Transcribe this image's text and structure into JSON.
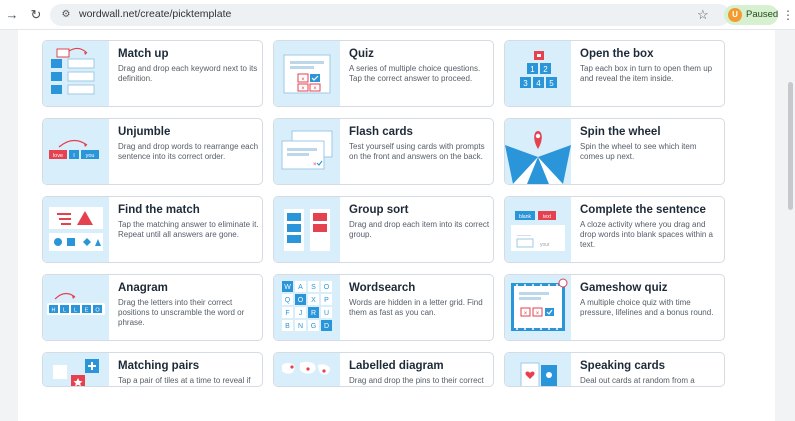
{
  "browser": {
    "url": "wordwall.net/create/picktemplate",
    "profile_status": "Paused",
    "profile_initial": "U"
  },
  "templates": [
    {
      "title": "Match up",
      "description": "Drag and drop each keyword next to its definition."
    },
    {
      "title": "Quiz",
      "description": "A series of multiple choice questions. Tap the correct answer to proceed."
    },
    {
      "title": "Open the box",
      "description": "Tap each box in turn to open them up and reveal the item inside."
    },
    {
      "title": "Unjumble",
      "description": "Drag and drop words to rearrange each sentence into its correct order."
    },
    {
      "title": "Flash cards",
      "description": "Test yourself using cards with prompts on the front and answers on the back."
    },
    {
      "title": "Spin the wheel",
      "description": "Spin the wheel to see which item comes up next."
    },
    {
      "title": "Find the match",
      "description": "Tap the matching answer to eliminate it. Repeat until all answers are gone."
    },
    {
      "title": "Group sort",
      "description": "Drag and drop each item into its correct group."
    },
    {
      "title": "Complete the sentence",
      "description": "A cloze activity where you drag and drop words into blank spaces within a text."
    },
    {
      "title": "Anagram",
      "description": "Drag the letters into their correct positions to unscramble the word or phrase."
    },
    {
      "title": "Wordsearch",
      "description": "Words are hidden in a letter grid. Find them as fast as you can."
    },
    {
      "title": "Gameshow quiz",
      "description": "A multiple choice quiz with time pressure, lifelines and a bonus round."
    },
    {
      "title": "Matching pairs",
      "description": "Tap a pair of tiles at a time to reveal if they are a match."
    },
    {
      "title": "Labelled diagram",
      "description": "Drag and drop the pins to their correct place on the image."
    },
    {
      "title": "Speaking cards",
      "description": "Deal out cards at random from a shuffled deck."
    }
  ],
  "thumb_text": {
    "box_numbers": [
      "1",
      "2",
      "3",
      "4",
      "5"
    ],
    "unjumble_words": [
      "love",
      "I",
      "you"
    ],
    "anagram_letters": [
      "H",
      "L",
      "L",
      "E",
      "O"
    ],
    "wordsearch_letters": [
      "W",
      "A",
      "S",
      "O",
      "Q",
      "O",
      "X",
      "P",
      "F",
      "J",
      "R",
      "U",
      "B",
      "N",
      "G",
      "D"
    ],
    "cloze_words": [
      "blank",
      "text"
    ],
    "cloze_placeholder": "_____",
    "cloze_tail": "your"
  },
  "colors": {
    "accent_blue": "#2b95d9",
    "accent_red": "#e5414f",
    "thumb_bg": "#d9eefb"
  }
}
